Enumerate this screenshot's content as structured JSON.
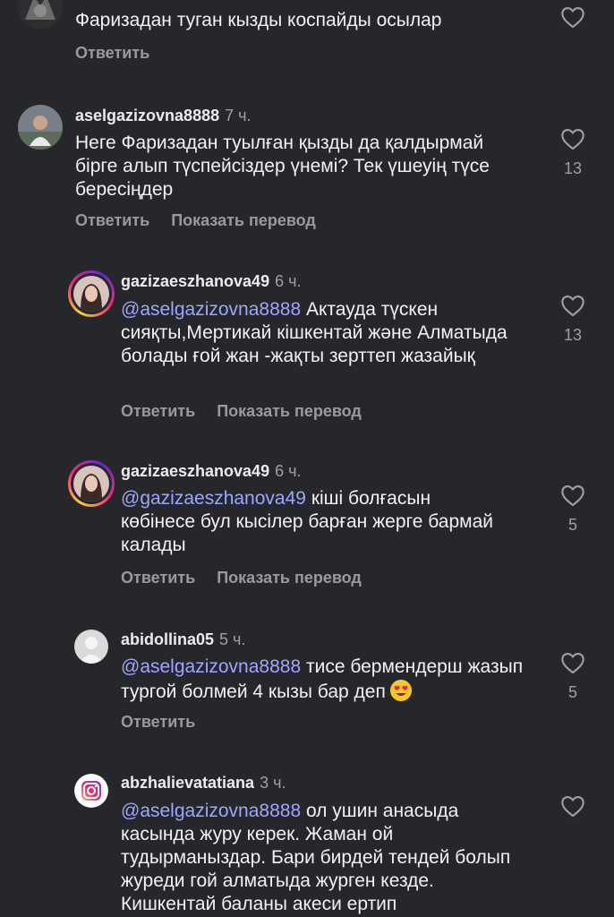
{
  "reply_label": "Ответить",
  "translate_label": "Показать перевод",
  "comments": [
    {
      "username": "",
      "time": "",
      "text": "Фаризадан туган кызды коспайды осылар",
      "likes": ""
    },
    {
      "username": "aselgazizovna8888",
      "time": "7 ч.",
      "text": "Неге Фаризадан туылған қызды да қалдырмай бірге алып түспейсіздер үнемі? Тек үшеуің түсе бересіңдер",
      "likes": "13"
    },
    {
      "username": "gazizaeszhanova49",
      "time": "6 ч.",
      "mention": "@aselgazizovna8888",
      "text": "Актауда түскен сияқты,Мертикай кішкентай және Алматыда болады ғой жан -жақты зерттеп жазайық",
      "likes": "13"
    },
    {
      "username": "gazizaeszhanova49",
      "time": "6 ч.",
      "mention": "@gazizaeszhanova49",
      "text": "кіші болғасын көбінесе бул кысілер барған жерге бармай калады",
      "likes": "5"
    },
    {
      "username": "abidollina05",
      "time": "5 ч.",
      "mention": "@aselgazizovna8888",
      "text": "тисе бермендерш жазып тургой болмей 4 кызы бар деп",
      "emoji": "heart-eyes",
      "likes": "5"
    },
    {
      "username": "abzhalievatatiana",
      "time": "3 ч.",
      "mention": "@aselgazizovna8888",
      "text": "ол ушин анасыда касында журу керек. Жаман ой тудырманыздар. Бари бирдей тендей болып журеди гой алматыда журген кезде. Кишкентай баланы акеси ертип",
      "likes": ""
    }
  ],
  "colors": {
    "background": "#26272b",
    "mention": "#9ea6ff",
    "secondary_text": "#9a9a9e"
  }
}
